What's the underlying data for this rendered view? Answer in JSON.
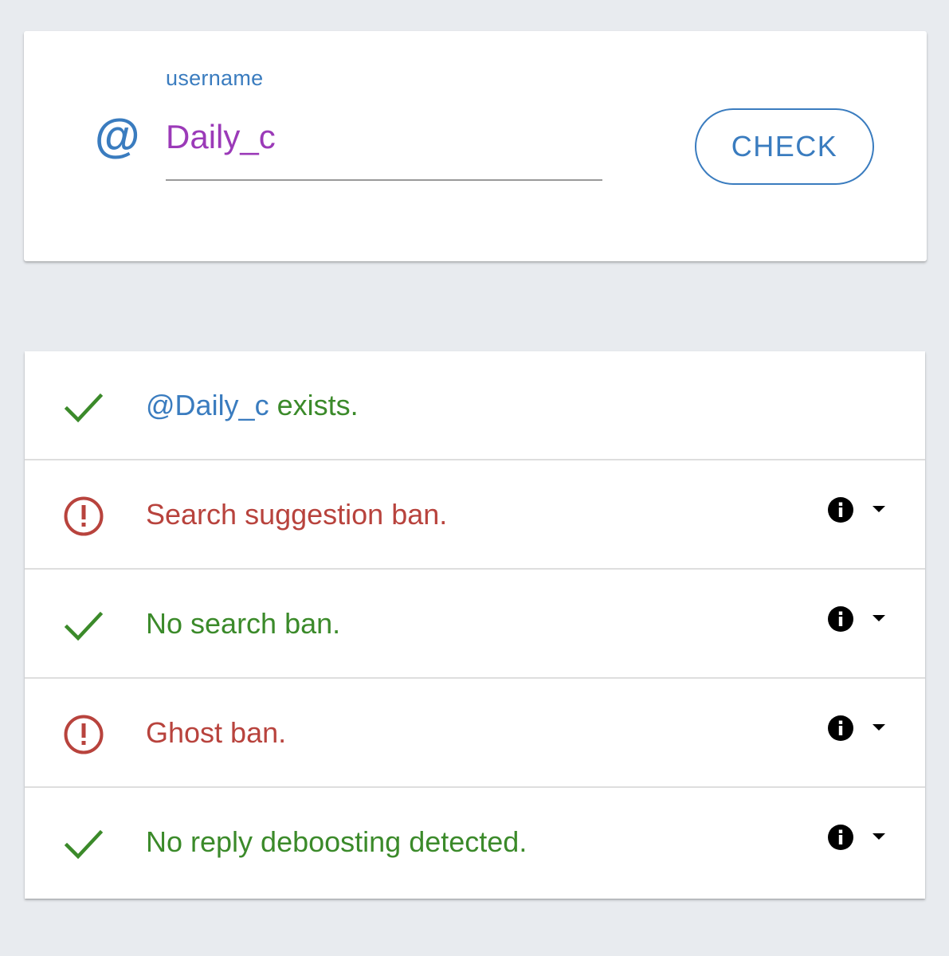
{
  "search": {
    "field_label": "username",
    "prefix_symbol": "@",
    "username_value": "Daily_c",
    "check_button_label": "CHECK"
  },
  "results": {
    "exists": {
      "status": "ok",
      "handle": "@Daily_c",
      "text": " exists."
    },
    "search_suggestion_ban": {
      "status": "warning",
      "text": "Search suggestion ban."
    },
    "search_ban": {
      "status": "ok",
      "text": "No search ban."
    },
    "ghost_ban": {
      "status": "warning",
      "text": "Ghost ban."
    },
    "reply_deboosting": {
      "status": "ok",
      "text": "No reply deboosting detected."
    }
  },
  "icons": {
    "ok": "check-mark-icon",
    "warning": "exclamation-circle-icon",
    "info": "info-circle-icon",
    "expand": "caret-down-icon"
  },
  "colors": {
    "accent_blue": "#3a7cbf",
    "input_purple": "#9b3ab8",
    "ok_green": "#3b8a2a",
    "error_red": "#b8433d",
    "background": "#e8ebef"
  }
}
